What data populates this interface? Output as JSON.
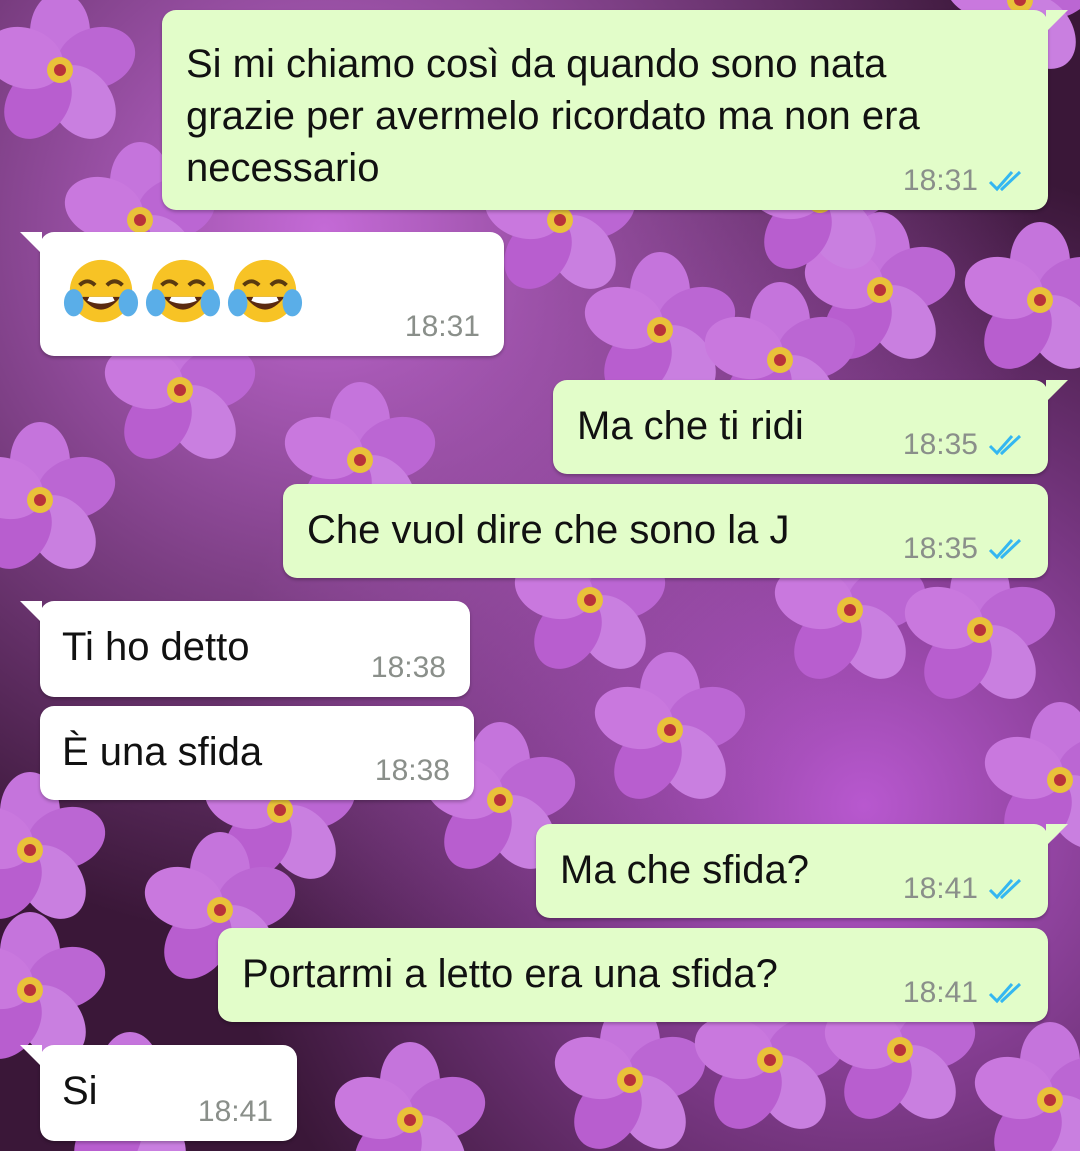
{
  "theme": {
    "outgoing_bubble": "#e2fdc9",
    "incoming_bubble": "#ffffff",
    "tick_color": "#34b7f1",
    "time_color": "#8a8f8a"
  },
  "messages": [
    {
      "direction": "outgoing",
      "text": "Si mi chiamo così da quando sono nata\ngrazie per avermelo ricordato ma non era\nnecessario",
      "time": "18:31",
      "status": "read"
    },
    {
      "direction": "incoming",
      "emoji": [
        "face-with-tears-of-joy",
        "face-with-tears-of-joy",
        "face-with-tears-of-joy"
      ],
      "time": "18:31"
    },
    {
      "direction": "outgoing",
      "text": "Ma che ti ridi",
      "time": "18:35",
      "status": "read"
    },
    {
      "direction": "outgoing",
      "text": "Che vuol dire che sono la J",
      "time": "18:35",
      "status": "read"
    },
    {
      "direction": "incoming",
      "text": "Ti ho detto",
      "time": "18:38"
    },
    {
      "direction": "incoming",
      "text": "È una sfida",
      "time": "18:38"
    },
    {
      "direction": "outgoing",
      "text": "Ma che sfida?",
      "time": "18:41",
      "status": "read"
    },
    {
      "direction": "outgoing",
      "text": "Portarmi a letto era una sfida?",
      "time": "18:41",
      "status": "read"
    },
    {
      "direction": "incoming",
      "text": "Si",
      "time": "18:41"
    }
  ]
}
